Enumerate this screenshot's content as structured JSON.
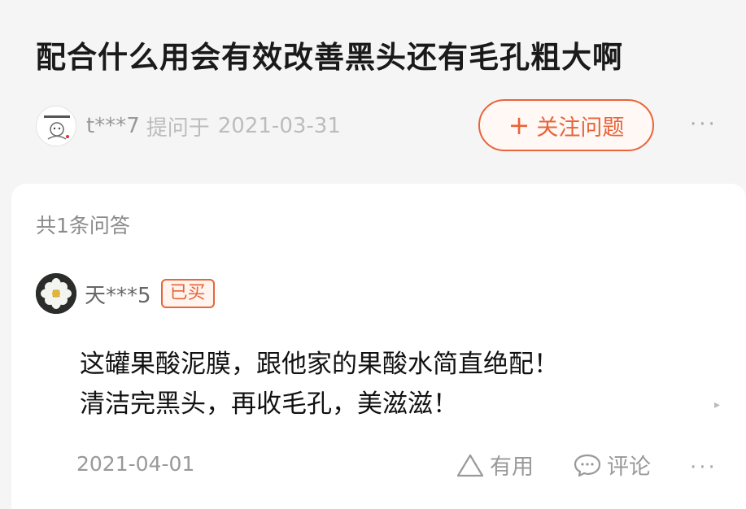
{
  "question": {
    "title": "配合什么用会有效改善黑头还有毛孔粗大啊",
    "asker": "t***7",
    "prefix": "提问于",
    "date": "2021-03-31",
    "follow_label": "关注问题",
    "follow_plus": "+",
    "more": "···"
  },
  "answers_section": {
    "count_label": "共1条问答"
  },
  "answer": {
    "user": "天***5",
    "badge": "已买",
    "text_line1": "这罐果酸泥膜，跟他家的果酸水简直绝配！",
    "text_line2": "清洁完黑头，再收毛孔，美滋滋！",
    "date": "2021-04-01",
    "useful_label": "有用",
    "comment_label": "评论",
    "more": "···",
    "scroll_arrow": "▸"
  },
  "colors": {
    "accent": "#e8643a",
    "background": "#f5f5f5",
    "card": "#ffffff"
  },
  "icons": {
    "useful": "triangle-icon",
    "comment": "speech-bubble-icon",
    "follow": "plus-icon"
  }
}
